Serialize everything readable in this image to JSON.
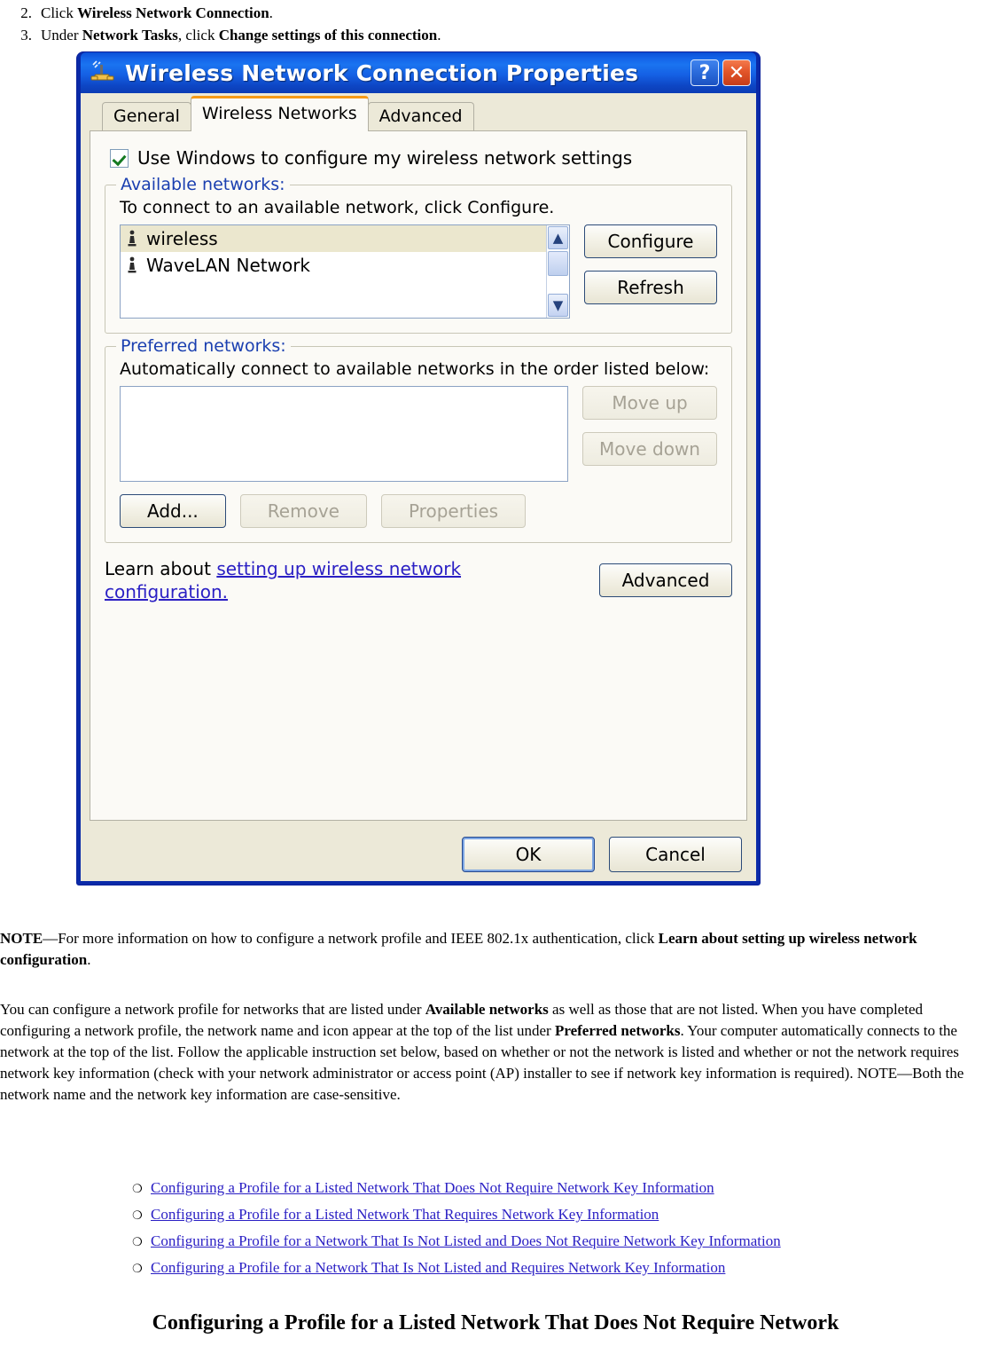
{
  "steps": [
    {
      "num": "2.",
      "pre": "Click ",
      "bold": "Wireless Network Connection",
      "post": "."
    },
    {
      "num": "3.",
      "pre": "Under ",
      "bold": "Network Tasks",
      "mid": ", click ",
      "bold2": "Change settings of this connection",
      "post": "."
    }
  ],
  "dialog": {
    "title": "Wireless Network Connection Properties",
    "title_icon": "wireless-network-icon",
    "help_button": "?",
    "close_button": "✕",
    "tabs": [
      {
        "label": "General",
        "active": false
      },
      {
        "label": "Wireless Networks",
        "active": true
      },
      {
        "label": "Advanced",
        "active": false
      }
    ],
    "use_windows_checkbox": {
      "label": "Use Windows to configure my wireless network settings",
      "checked": true
    },
    "available_networks": {
      "title": "Available networks:",
      "hint": "To connect to an available network, click Configure.",
      "items": [
        {
          "name": "wireless",
          "selected": true
        },
        {
          "name": "WaveLAN Network",
          "selected": false
        }
      ],
      "buttons": [
        {
          "label": "Configure",
          "disabled": false
        },
        {
          "label": "Refresh",
          "disabled": false
        }
      ]
    },
    "preferred_networks": {
      "title": "Preferred networks:",
      "hint": "Automatically connect to available networks in the order listed below:",
      "items": [],
      "side_buttons": [
        {
          "label": "Move up",
          "disabled": true
        },
        {
          "label": "Move down",
          "disabled": true
        }
      ],
      "bottom_buttons": [
        {
          "label": "Add...",
          "disabled": false
        },
        {
          "label": "Remove",
          "disabled": true
        },
        {
          "label": "Properties",
          "disabled": true
        }
      ]
    },
    "learn": {
      "prefix": "Learn about ",
      "link": "setting up wireless network configuration.",
      "advanced_button": "Advanced"
    },
    "footer_buttons": [
      {
        "label": "OK",
        "default": true
      },
      {
        "label": "Cancel",
        "default": false
      }
    ]
  },
  "note": {
    "label": "NOTE",
    "dash": "—",
    "text": "For more information on how to configure a network profile and IEEE 802.1x authentication, click ",
    "bold": "Learn about setting up wireless network configuration",
    "post": "."
  },
  "body_paragraph": {
    "p1": "You can configure a network profile for networks that are listed under ",
    "b1": "Available networks",
    "p2": " as well as those that are not listed. When you have completed configuring a network profile, the network name and icon appear at the top of the list under ",
    "b2": "Preferred networks",
    "p3": ". Your computer automatically connects to the network at the top of the list. Follow the applicable instruction set below, based on whether or not the network is listed and whether or not the network requires network key information (check with your network administrator or access point (AP) installer to see if network key information is required). NOTE—Both the network name and the network key information are case-sensitive."
  },
  "link_list": {
    "bullet": "❍",
    "items": [
      "Configuring a Profile for a Listed Network That Does Not Require Network Key Information",
      "Configuring a Profile for a Listed Network That Requires Network Key Information",
      "Configuring a Profile for a Network That Is Not Listed and Does Not Require Network Key Information",
      "Configuring a Profile for a Network That Is Not Listed and Requires Network Key Information"
    ]
  },
  "section_heading": "Configuring a Profile for a Listed Network That Does Not Require Network",
  "colors": {
    "title_bar_blue": "#1463e8",
    "dialog_frame": "#0a2aa8",
    "tab_active_accent": "#f59a18",
    "group_label": "#1a3fb0",
    "link": "#2a1fc4",
    "selection": "#ebe7ce",
    "dialog_face": "#ece9d8"
  }
}
